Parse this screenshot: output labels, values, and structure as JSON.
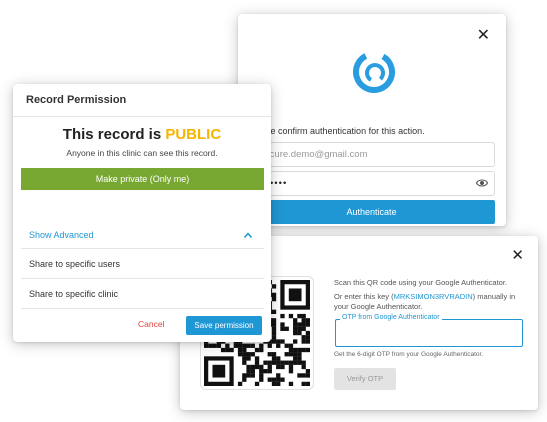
{
  "auth_dialog": {
    "close_glyph": "✕",
    "logo_icon": "mycure-logo-icon",
    "prompt": "Please confirm authentication for this action.",
    "email_value": "mycure.demo@gmail.com",
    "password_value": "•••••••",
    "authenticate_label": "Authenticate"
  },
  "permission_dialog": {
    "title": "Record Permission",
    "status_prefix": "This record is ",
    "status_value": "PUBLIC",
    "subtitle": "Anyone in this clinic can see this record.",
    "make_private_label": "Make private (Only me)",
    "show_advanced_label": "Show Advanced",
    "share_users_label": "Share to specific users",
    "share_clinic_label": "Share to specific clinic",
    "cancel_label": "Cancel",
    "save_label": "Save permission"
  },
  "otp_dialog": {
    "close_glyph": "✕",
    "scan_text": "Scan this QR code using your Google Authenticator.",
    "key_prefix": "Or enter this key (",
    "key_value": "MRKSIMON3RVRADIN",
    "key_suffix": ") manually in your Google Authenticator.",
    "otp_field_label": "OTP from Google Authenticator",
    "otp_value": "",
    "hint": "Get the 6-digit OTP from your Google Authenticator.",
    "verify_label": "Verify OTP"
  },
  "colors": {
    "accent_blue": "#1f97d4",
    "public_yellow": "#f5b400",
    "private_green": "#78a832",
    "cancel_red": "#e2413b"
  }
}
